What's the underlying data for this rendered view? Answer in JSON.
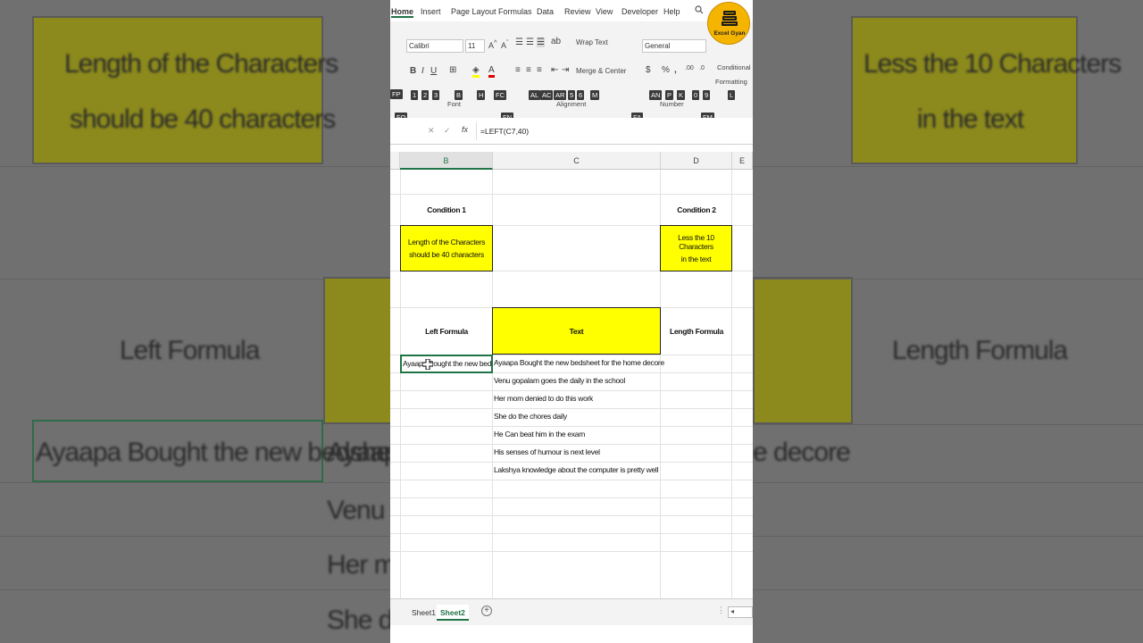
{
  "ribbon_tabs": [
    "Home",
    "Insert",
    "Page Layout",
    "Formulas",
    "Data",
    "Review",
    "View",
    "Developer",
    "Help"
  ],
  "keytips": {
    "tabs": [
      "FF",
      "FS",
      "FG",
      "FK",
      "AT",
      "AM",
      "AB",
      "FQ",
      "W",
      "N"
    ],
    "row2": [
      "1",
      "2",
      "3",
      "B",
      "H",
      "FC",
      "AL",
      "AC",
      "AR",
      "5",
      "6",
      "M",
      "AN",
      "P",
      "K",
      "0",
      "9",
      "L"
    ],
    "row3": [
      "FO",
      "FN",
      "FA",
      "FM"
    ],
    "left": [
      "FP"
    ]
  },
  "ribbon": {
    "font_name": "Calibri",
    "font_size": "11",
    "wrap_text": "Wrap Text",
    "merge_center": "Merge & Center",
    "number_format": "General",
    "conditional_formatting_1": "Conditional",
    "conditional_formatting_2": "Formatting",
    "group_font": "Font",
    "group_alignment": "Alignment",
    "group_number": "Number",
    "icon_names": [
      "bold-icon",
      "italic-icon",
      "underline-icon",
      "borders-icon",
      "fill-color-icon",
      "font-color-icon",
      "align-icons",
      "wrap-text-icon",
      "merge-icon",
      "currency-icon",
      "percent-icon",
      "comma-icon",
      "decimal-icons",
      "search-icon"
    ]
  },
  "formula_bar": {
    "cancel": "✕",
    "enter": "✓",
    "fx": "fx",
    "formula": "=LEFT(C7,40)"
  },
  "columns": [
    "B",
    "C",
    "D",
    "E"
  ],
  "cells": {
    "condition1_label": "Condition 1",
    "condition1_text_line1": "Length of the Characters",
    "condition1_text_line2": "should be 40 characters",
    "condition2_label": "Condition 2",
    "condition2_text_line1": "Less the 10 Characters",
    "condition2_text_line2": "in the text",
    "header_left_formula": "Left Formula",
    "header_text": "Text",
    "header_length_formula": "Length Formula",
    "active_cell_value": "Ayaapa Bought the new bedshe"
  },
  "text_rows": [
    "Ayaapa Bought the new bedsheet for the home decore",
    "Venu gopalam goes the daily in the school",
    "Her mom denied to do this work",
    "She do the chores daily",
    "He Can beat him in the exam",
    "His senses of humour is next level",
    "Lakshya knowledge about the computer is pretty well"
  ],
  "sheets": [
    "Sheet1",
    "Sheet2"
  ],
  "active_sheet": "Sheet2",
  "logo_text": "Excel Gyan",
  "backdrop": {
    "left_box": "Length of the Characters should be 40 characters",
    "left_header": "Left Formula",
    "left_cell": "Ayaapa Bought the new bedshe",
    "right_box": "Less the 10 Characters in the text",
    "right_header": "Length Formula",
    "right_cell": "e decore",
    "mid_rows": [
      "Ayaap",
      "Venu g",
      "Her mo",
      "She do"
    ]
  },
  "colors": {
    "yellow": "#ffff00",
    "excel_green": "#217346",
    "logo_orange": "#f5b400"
  }
}
